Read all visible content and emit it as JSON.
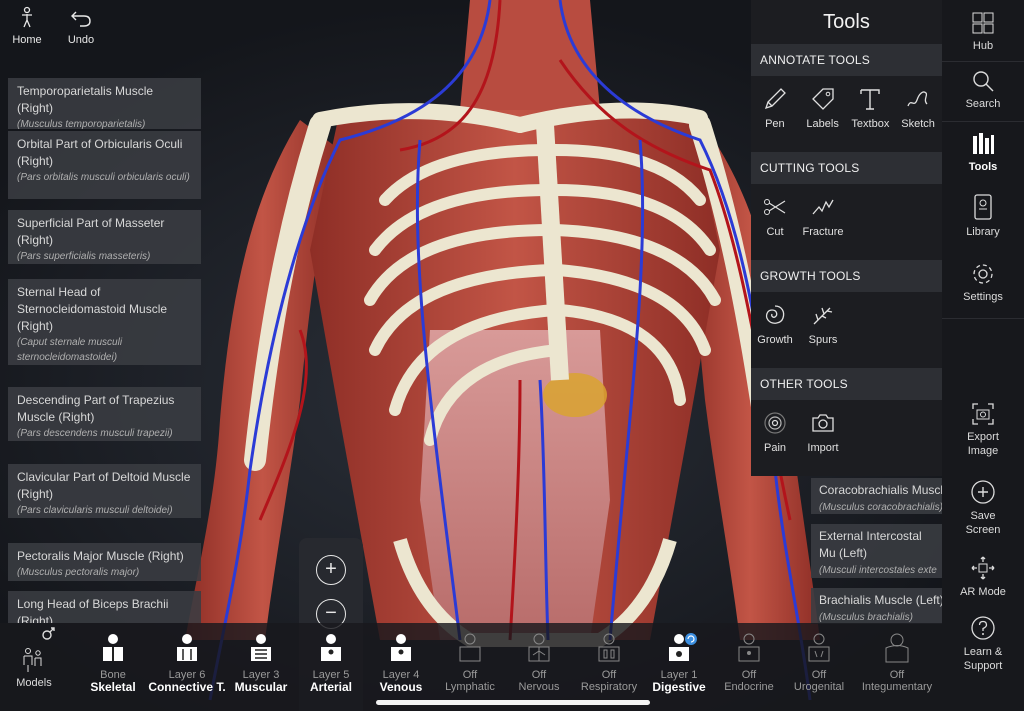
{
  "top_left": {
    "home_label": "Home",
    "undo_label": "Undo"
  },
  "left_labels": [
    {
      "name": "Temporoparietalis Muscle (Right)",
      "latin": "(Musculus temporoparietalis)"
    },
    {
      "name": "Orbital Part of Orbicularis Oculi (Right)",
      "latin": "(Pars orbitalis musculi orbicularis oculi)"
    },
    {
      "name": "Superficial Part of Masseter (Right)",
      "latin": "(Pars superficialis masseteris)"
    },
    {
      "name": "Sternal Head of Sternocleidomastoid Muscle (Right)",
      "latin": "(Caput sternale musculi sternocleidomastoidei)"
    },
    {
      "name": "Descending Part of Trapezius Muscle (Right)",
      "latin": "(Pars descendens musculi trapezii)"
    },
    {
      "name": "Clavicular Part of Deltoid Muscle (Right)",
      "latin": "(Pars clavicularis musculi deltoidei)"
    },
    {
      "name": "Pectoralis Major Muscle (Right)",
      "latin": "(Musculus pectoralis major)"
    },
    {
      "name": "Long Head of Biceps Brachii (Right)",
      "latin": ""
    }
  ],
  "right_labels": [
    {
      "name": "Coracobrachialis Muscle",
      "latin": "(Musculus coracobrachialis)"
    },
    {
      "name": "External Intercostal Mu (Left)",
      "latin": "(Musculi intercostales exte"
    },
    {
      "name": "Brachialis Muscle (Left)",
      "latin": "(Musculus brachialis)"
    }
  ],
  "tools_panel": {
    "title": "Tools",
    "sections": [
      {
        "heading": "ANNOTATE TOOLS",
        "items": [
          "Pen",
          "Labels",
          "Textbox",
          "Sketch"
        ]
      },
      {
        "heading": "CUTTING TOOLS",
        "items": [
          "Cut",
          "Fracture"
        ]
      },
      {
        "heading": "GROWTH TOOLS",
        "items": [
          "Growth",
          "Spurs"
        ]
      },
      {
        "heading": "OTHER TOOLS",
        "items": [
          "Pain",
          "Import"
        ]
      }
    ]
  },
  "sidebar": {
    "hub": "Hub",
    "search": "Search",
    "tools": "Tools",
    "library": "Library",
    "settings": "Settings",
    "export": "Export Image",
    "save": "Save Screen",
    "ar": "AR Mode",
    "learn": "Learn & Support"
  },
  "zoom": {
    "in": "+",
    "out": "−"
  },
  "bottom_bar": {
    "models_label": "Models",
    "layers": [
      {
        "status": "Bone",
        "name": "Skeletal",
        "on": true
      },
      {
        "status": "Layer 6",
        "name": "Connective T.",
        "on": true
      },
      {
        "status": "Layer 3",
        "name": "Muscular",
        "on": true
      },
      {
        "status": "Layer 5",
        "name": "Arterial",
        "on": true
      },
      {
        "status": "Layer 4",
        "name": "Venous",
        "on": true
      },
      {
        "status": "Off",
        "name": "Lymphatic",
        "on": false
      },
      {
        "status": "Off",
        "name": "Nervous",
        "on": false
      },
      {
        "status": "Off",
        "name": "Respiratory",
        "on": false
      },
      {
        "status": "Layer 1",
        "name": "Digestive",
        "on": true
      },
      {
        "status": "Off",
        "name": "Endocrine",
        "on": false
      },
      {
        "status": "Off",
        "name": "Urogenital",
        "on": false
      },
      {
        "status": "Off",
        "name": "Integumentary",
        "on": false
      }
    ]
  },
  "colors": {
    "panel_bg": "#1c1d21",
    "section_head_bg": "#2d2f34",
    "muscle": "#b0453a",
    "bone": "#e8e2cc",
    "vein": "#2b3bd6",
    "artery": "#b3141b"
  }
}
